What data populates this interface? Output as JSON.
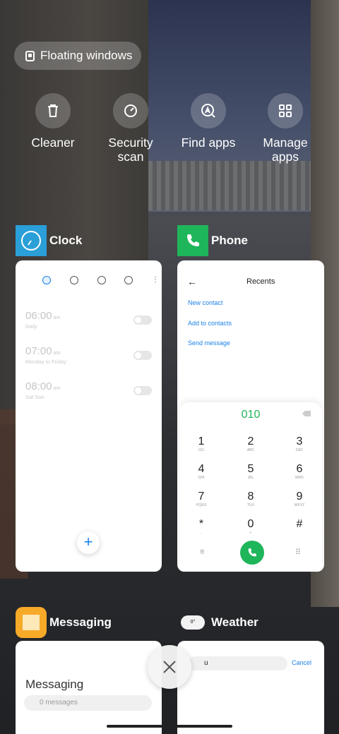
{
  "floating": {
    "label": "Floating windows"
  },
  "tools": [
    {
      "label": "Cleaner",
      "icon": "trash-icon"
    },
    {
      "label": "Security\nscan",
      "icon": "security-scan-icon"
    },
    {
      "label": "Find apps",
      "icon": "find-apps-icon"
    },
    {
      "label": "Manage\napps",
      "icon": "manage-apps-icon"
    }
  ],
  "apps": {
    "clock": {
      "name": "Clock",
      "alarms": [
        {
          "time": "06:00",
          "ampm": "am",
          "repeat": "Daily"
        },
        {
          "time": "07:00",
          "ampm": "am",
          "repeat": "Monday to Friday"
        },
        {
          "time": "08:00",
          "ampm": "am",
          "repeat": "Sat Sun"
        }
      ],
      "fab": "+"
    },
    "phone": {
      "name": "Phone",
      "back": "←",
      "title": "Recents",
      "links": [
        "New contact",
        "Add to contacts",
        "Send message"
      ],
      "number": "010",
      "keys": [
        {
          "d": "1",
          "l": "GO"
        },
        {
          "d": "2",
          "l": "ABC"
        },
        {
          "d": "3",
          "l": "DEF"
        },
        {
          "d": "4",
          "l": "GHI"
        },
        {
          "d": "5",
          "l": "JKL"
        },
        {
          "d": "6",
          "l": "MNO"
        },
        {
          "d": "7",
          "l": "PQRS"
        },
        {
          "d": "8",
          "l": "TUV"
        },
        {
          "d": "9",
          "l": "WXYZ"
        },
        {
          "d": "*",
          "l": ","
        },
        {
          "d": "0",
          "l": "+"
        },
        {
          "d": "#",
          "l": ""
        }
      ],
      "menu": "≡",
      "dialpad": "⠿"
    },
    "messaging": {
      "name": "Messaging",
      "title": "Messaging",
      "search": "0 messages"
    },
    "weather": {
      "name": "Weather",
      "temp": "0°",
      "query": "u",
      "cancel": "Cancel"
    }
  },
  "colors": {
    "accent": "#1a82e8",
    "call": "#1fb55a",
    "clock_icon": "#2a9fd8",
    "phone_icon": "#1fb55a",
    "messaging_icon": "#f7a928"
  }
}
